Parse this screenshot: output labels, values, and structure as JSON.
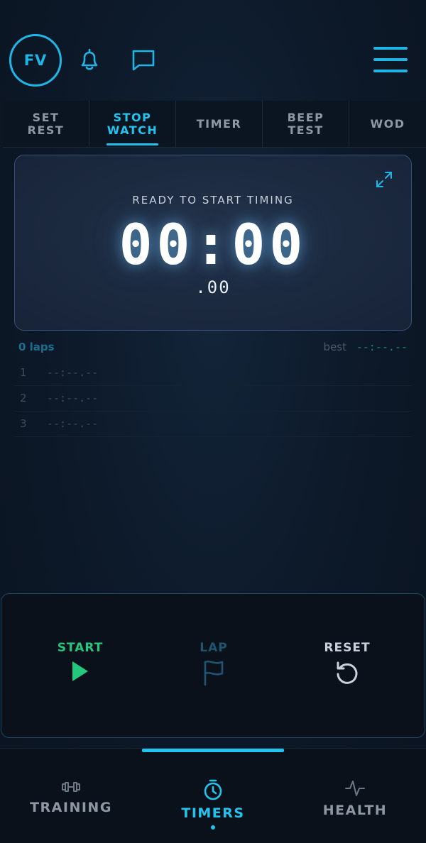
{
  "header": {
    "avatar_initials": "FV",
    "icons": [
      "bell-icon",
      "chat-icon",
      "menu-icon"
    ]
  },
  "tabs": [
    {
      "label": "SET\nREST",
      "active": false
    },
    {
      "label": "STOP\nWATCH",
      "active": true
    },
    {
      "label": "TIMER",
      "active": false
    },
    {
      "label": "BEEP\nTEST",
      "active": false
    },
    {
      "label": "WOD",
      "active": false
    }
  ],
  "stopwatch": {
    "status": "READY TO START TIMING",
    "time": "00:00",
    "centiseconds": ".00"
  },
  "laps": {
    "count_label": "0 laps",
    "best_label": "best",
    "best_value": "--:--.--",
    "rows": [
      {
        "number": "1",
        "time": "--:--.--"
      },
      {
        "number": "2",
        "time": "--:--.--"
      },
      {
        "number": "3",
        "time": "--:--.--"
      }
    ]
  },
  "controls": {
    "start_label": "START",
    "lap_label": "LAP",
    "reset_label": "RESET"
  },
  "bottom_nav": {
    "training_label": "TRAINING",
    "timers_label": "TIMERS",
    "health_label": "HEALTH",
    "active": "timers"
  },
  "colors": {
    "accent": "#22c4ef",
    "start_green": "#23c77d",
    "background": "#0d1a2a"
  }
}
